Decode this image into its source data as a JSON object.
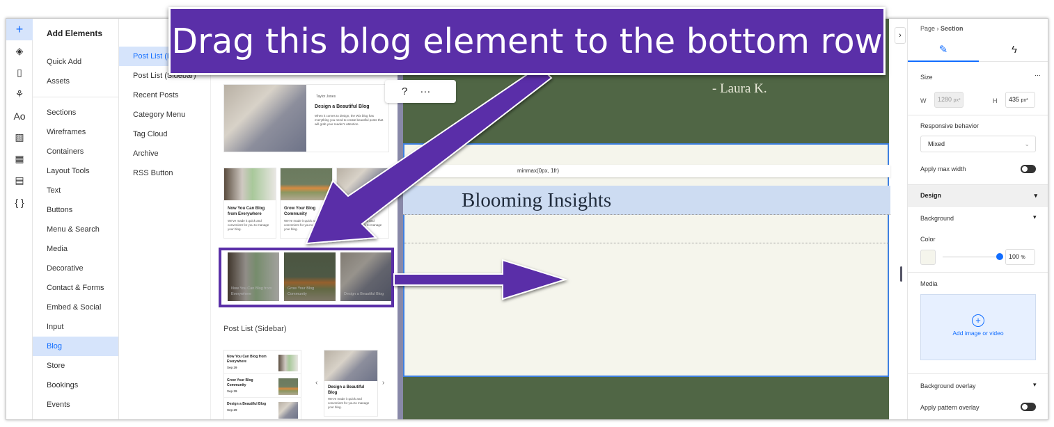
{
  "banner": {
    "text": "Drag this blog element to the bottom row"
  },
  "rail": {
    "icons": [
      "plus-icon",
      "layers-icon",
      "page-icon",
      "apps-icon",
      "typography-icon",
      "media-icon",
      "grid-icon",
      "table-icon",
      "code-icon"
    ]
  },
  "add_elements": {
    "title": "Add Elements",
    "top": [
      "Quick Add",
      "Assets"
    ],
    "categories": [
      "Sections",
      "Wireframes",
      "Containers",
      "Layout Tools",
      "Text",
      "Buttons",
      "Menu & Search",
      "Media",
      "Decorative",
      "Contact & Forms",
      "Embed & Social",
      "Input",
      "Blog",
      "Store",
      "Bookings",
      "Events"
    ],
    "selected": "Blog"
  },
  "blog_sub": {
    "items": [
      "Post List (Large)",
      "Post List (Sidebar)",
      "Recent Posts",
      "Category Menu",
      "Tag Cloud",
      "Archive",
      "RSS Button"
    ],
    "selected": "Post List (Large)"
  },
  "preview": {
    "featured": {
      "author": "Taylor Jones",
      "title": "Design a Beautiful Blog",
      "desc": "When it comes to design, the Wix blog has everything you need to create beautiful posts that will grab your reader's attention."
    },
    "grid": [
      {
        "title": "Now You Can Blog from Everywhere",
        "desc": "We've made it quick and convenient for you to manage your blog."
      },
      {
        "title": "Grow Your Blog Community",
        "desc": "We've made it quick and convenient for you to manage your blog."
      },
      {
        "title": "Design a Beautiful Blog",
        "desc": "We've made it quick and convenient for you to manage your blog."
      }
    ],
    "overlay": [
      "Now You Can Blog from Everywhere",
      "Grow Your Blog Community",
      "Design a Beautiful Blog"
    ],
    "sidebar_heading": "Post List (Sidebar)",
    "sidebar_list": [
      {
        "title": "Now You Can Blog from Everywhere",
        "date": "Sep 29"
      },
      {
        "title": "Grow Your Blog Community",
        "date": "Sep 29"
      },
      {
        "title": "Design a Beautiful Blog",
        "date": "Sep 29"
      }
    ],
    "slider": {
      "title": "Design a Beautiful Blog",
      "desc": "We've made it quick and convenient for you to manage your blog."
    }
  },
  "canvas": {
    "quote_author": "- Laura K.",
    "grid_label": "minmax(0px, 1fr)",
    "heading": "Blooming Insights",
    "toolbar": [
      "?",
      "···"
    ]
  },
  "inspector": {
    "breadcrumb": [
      "Page",
      "Section"
    ],
    "size_label": "Size",
    "w_label": "W",
    "w_value": "1280",
    "w_unit": "px*",
    "h_label": "H",
    "h_value": "435",
    "h_unit": "px*",
    "responsive_label": "Responsive behavior",
    "responsive_value": "Mixed",
    "max_width_label": "Apply max width",
    "max_width_on": false,
    "design_label": "Design",
    "background_label": "Background",
    "color_label": "Color",
    "opacity": "100",
    "opacity_unit": "%",
    "media_label": "Media",
    "add_media": "Add image or video",
    "overlay_label": "Background overlay",
    "pattern_label": "Apply pattern overlay",
    "pattern_on": false,
    "accent": "#116dff",
    "swatch": "#f5f5ec"
  },
  "colors": {
    "banner": "#5a2fa8",
    "canvas_green": "#506645",
    "section": "#f5f5ec"
  }
}
